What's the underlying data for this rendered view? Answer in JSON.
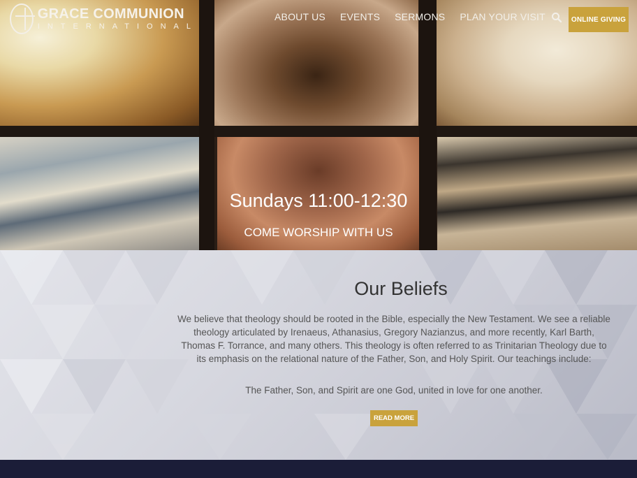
{
  "brand": {
    "name": "GRACE COMMUNION",
    "sub": "INTERNATIONAL"
  },
  "nav": {
    "items": [
      "ABOUT US",
      "EVENTS",
      "SERMONS",
      "PLAN YOUR VISIT"
    ],
    "giving": "ONLINE GIVING"
  },
  "hero": {
    "title": "Sundays 11:00-12:30",
    "subtitle": "COME WORSHIP WITH US"
  },
  "beliefs": {
    "title": "Our Beliefs",
    "body": "We believe that theology should be rooted in the Bible, especially the New Testament. We see a reliable theology articulated by Irenaeus, Athanasius, Gregory Nazianzus, and more recently, Karl Barth, Thomas F. Torrance, and many others. This theology is often referred to as Trinitarian Theology due to its emphasis on the relational nature of the Father, Son, and Holy Spirit. Our teachings include:",
    "line": "The Father, Son, and Spirit are one God, united in love for one another.",
    "button": "READ MORE"
  },
  "colors": {
    "accent": "#c9a23c",
    "footer": "#1b1d38"
  }
}
